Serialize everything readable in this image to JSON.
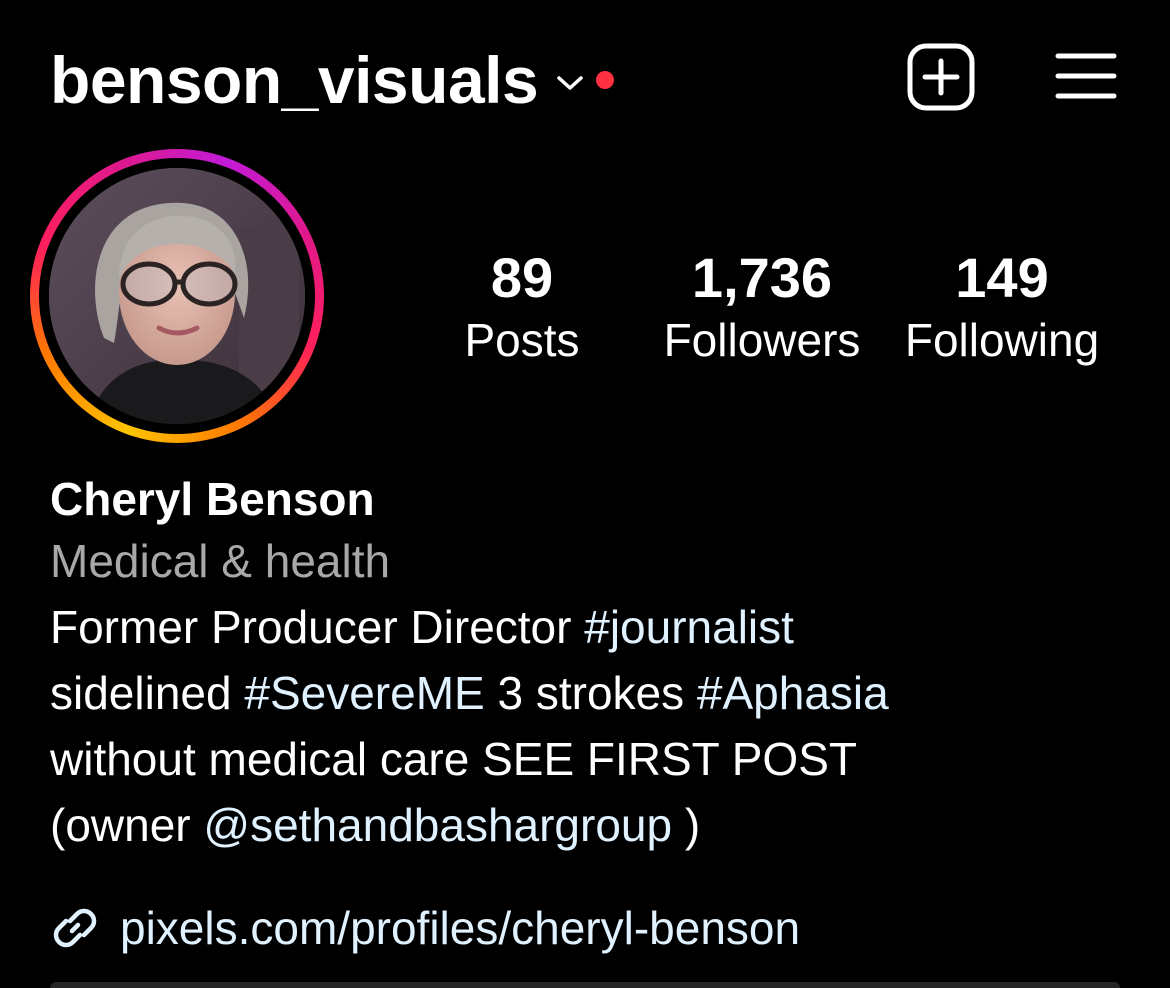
{
  "header": {
    "username": "benson_visuals",
    "notification_color": "#ff3040"
  },
  "profile": {
    "stats": [
      {
        "value": "89",
        "label": "Posts"
      },
      {
        "value": "1,736",
        "label": "Followers"
      },
      {
        "value": "149",
        "label": "Following"
      }
    ],
    "name": "Cheryl Benson",
    "category": "Medical & health",
    "bio": {
      "line1_text": "Former Producer Director ",
      "line1_tag": "#journalist",
      "line2_text1": "sidelined ",
      "line2_tag1": "#SevereME",
      "line2_text2": " 3 strokes ",
      "line2_tag2": "#Aphasia",
      "line3_text": "without medical care SEE FIRST POST",
      "line4_text1": "(owner ",
      "line4_mention": "@sethandbashargroup",
      "line4_text2": " )"
    },
    "link": "pixels.com/profiles/cheryl-benson"
  },
  "colors": {
    "link": "#e0f1ff",
    "secondary_text": "#a8a8a8",
    "story_ring": [
      "#fdc400",
      "#ff7a00",
      "#ff1f5c",
      "#c21bd8"
    ]
  },
  "icons": {
    "chevron": "chevron-down-icon",
    "create": "plus-square-icon",
    "menu": "hamburger-menu-icon",
    "link": "link-icon"
  }
}
